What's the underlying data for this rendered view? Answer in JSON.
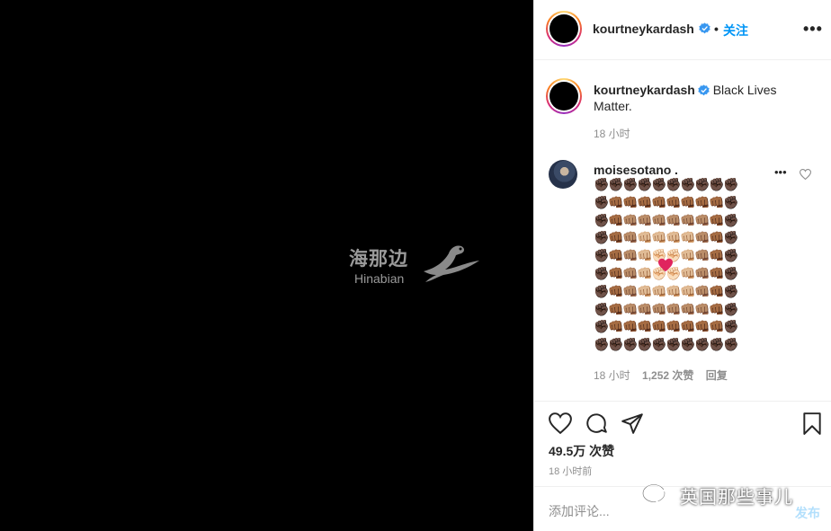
{
  "media": {
    "watermark_cn": "海那边",
    "watermark_en": "Hinabian"
  },
  "header": {
    "username": "kourtneykardash",
    "separator": "•",
    "follow_label": "关注",
    "more_icon": "ellipsis-icon",
    "more_label": "•••"
  },
  "caption": {
    "username": "kourtneykardash",
    "text": "Black Lives Matter.",
    "time": "18 小时"
  },
  "comment": {
    "username": "moisesotano",
    "trailing": ".",
    "more_label": "•••",
    "time": "18 小时",
    "likes": "1,252 次赞",
    "reply": "回复",
    "emoji_palette": [
      "✊🏿",
      "👊🏾",
      "👊🏽",
      "👊🏼",
      "✊🏻",
      "✊🏻",
      "👊🏼",
      "👊🏽",
      "👊🏾",
      "✊🏿"
    ]
  },
  "actions": {
    "like_icon": "heart-icon",
    "comment_icon": "comment-icon",
    "share_icon": "paper-plane-icon",
    "save_icon": "bookmark-icon"
  },
  "likes_total": "49.5万 次赞",
  "post_time": "18 小时前",
  "comment_box": {
    "placeholder": "添加评论...",
    "post_label": "发布"
  },
  "overlay_watermark": {
    "text": "英国那些事儿"
  },
  "colors": {
    "accent": "#0095f6",
    "post_disabled": "#b2dffc",
    "muted": "#8e8e8e",
    "text": "#262626"
  }
}
